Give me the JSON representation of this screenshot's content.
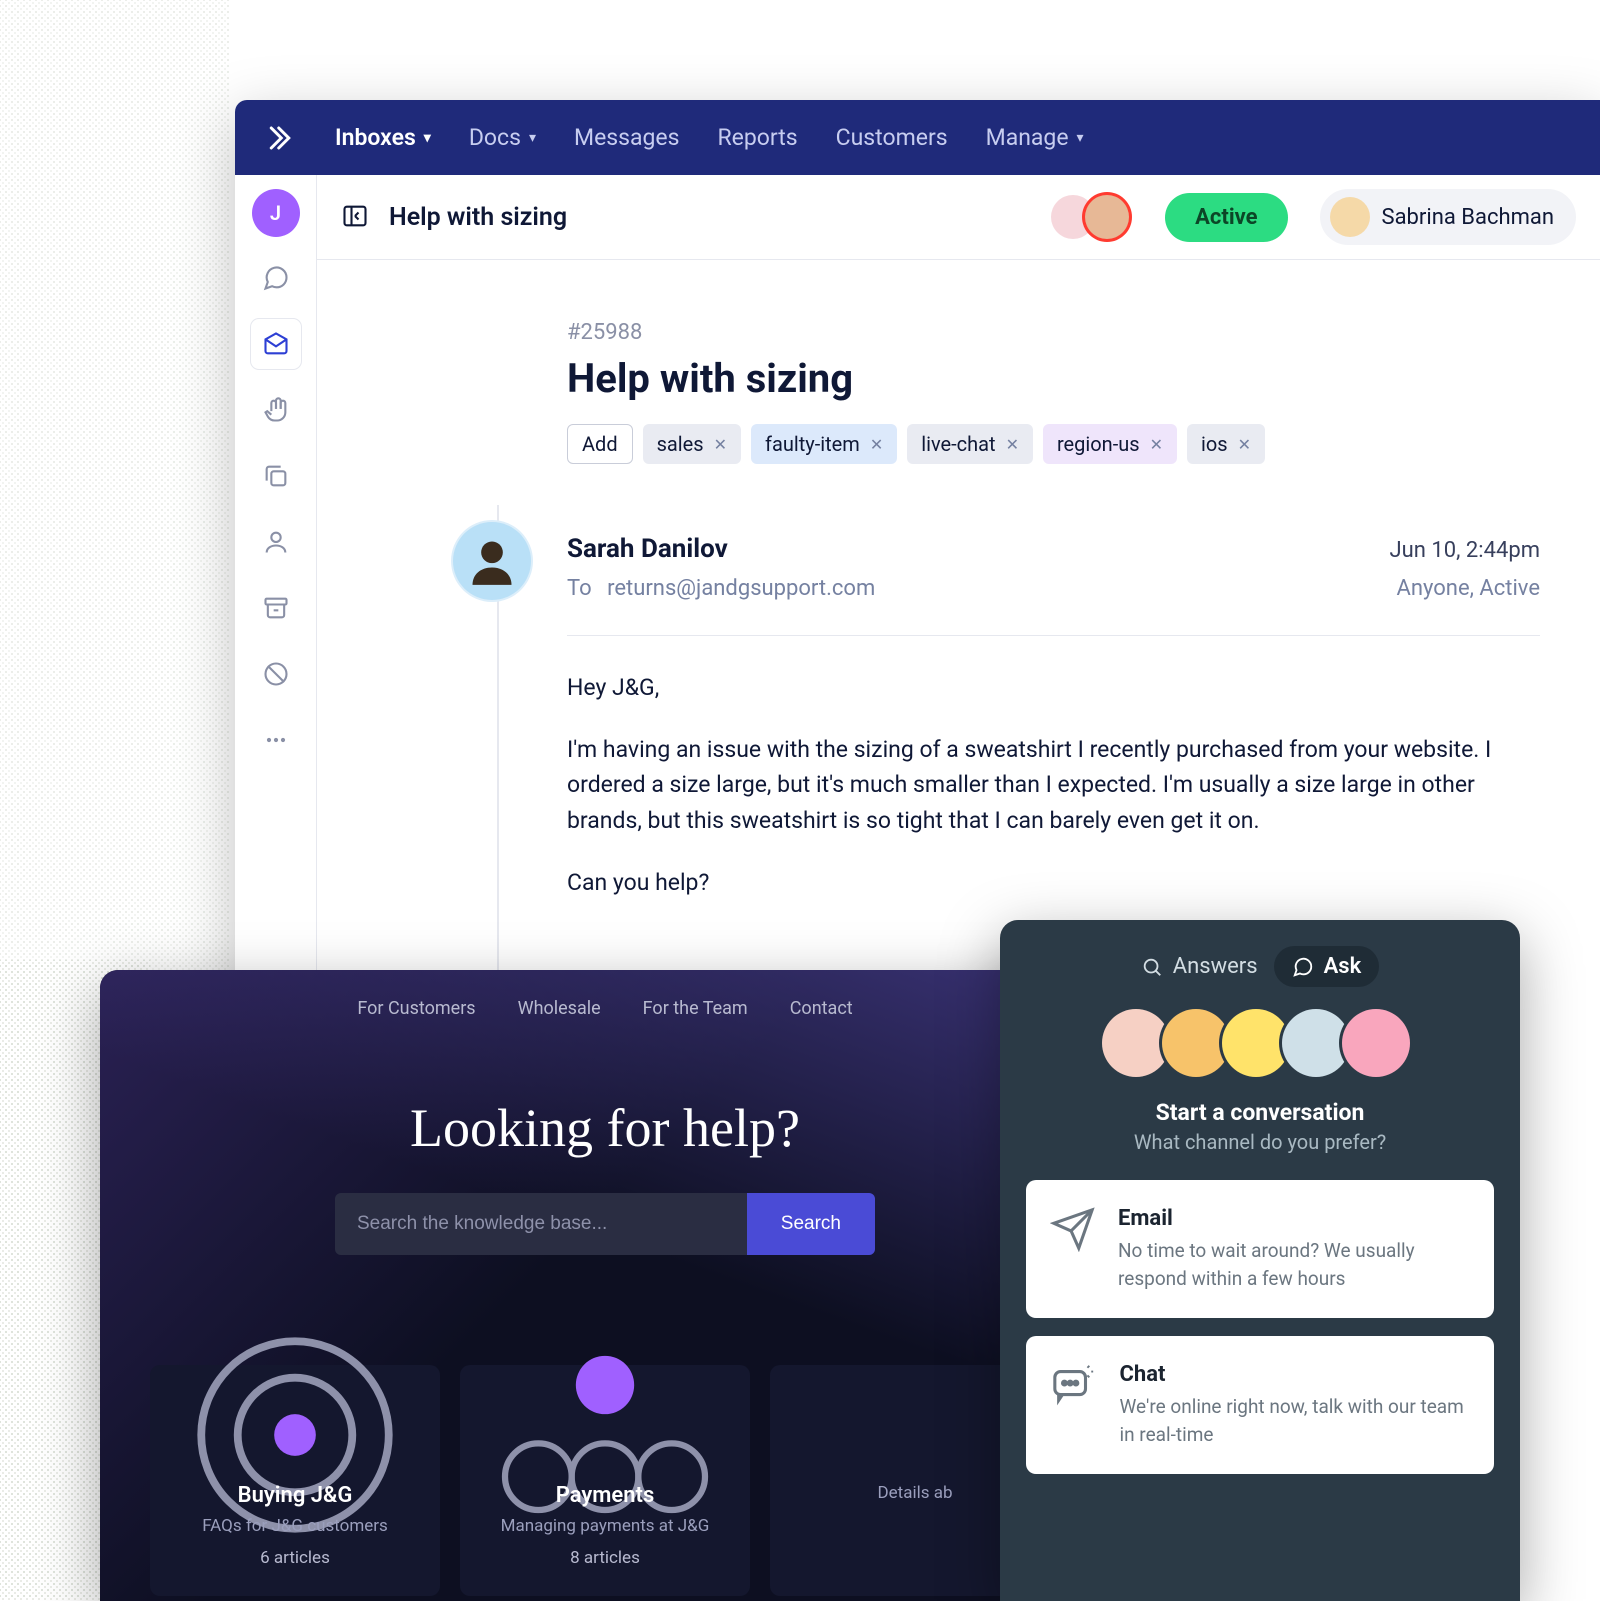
{
  "helpdesk": {
    "nav": {
      "inboxes": "Inboxes",
      "docs": "Docs",
      "messages": "Messages",
      "reports": "Reports",
      "customers": "Customers",
      "manage": "Manage"
    },
    "rail": {
      "avatar_letter": "J"
    },
    "header": {
      "title": "Help with sizing",
      "status": "Active",
      "assignee": "Sabrina Bachman"
    },
    "ticket": {
      "id": "#25988",
      "title": "Help with sizing",
      "add_label": "Add",
      "tags": [
        "sales",
        "faulty-item",
        "live-chat",
        "region-us",
        "ios"
      ]
    },
    "message": {
      "from": "Sarah Danilov",
      "date": "Jun 10, 2:44pm",
      "to_label": "To",
      "to_addr": "returns@jandgsupport.com",
      "meta": "Anyone, Active",
      "body": [
        "Hey J&G,",
        "I'm having an issue with the sizing of a sweatshirt I recently purchased from your website. I ordered a size large, but it's much smaller than I expected. I'm usually a size large in other brands, but this sweatshirt is so tight that I can barely even get it on.",
        "Can you help?"
      ]
    }
  },
  "kb": {
    "nav": [
      "For Customers",
      "Wholesale",
      "For the Team",
      "Contact"
    ],
    "hero": "Looking for help?",
    "search_placeholder": "Search the knowledge base...",
    "search_button": "Search",
    "cards": [
      {
        "title": "Buying J&G",
        "subtitle": "FAQs for J&G customers",
        "count": "6 articles"
      },
      {
        "title": "Payments",
        "subtitle": "Managing payments at J&G",
        "count": "8 articles"
      },
      {
        "title": "",
        "subtitle": "Details ab",
        "count": ""
      }
    ]
  },
  "widget": {
    "tabs": {
      "answers": "Answers",
      "ask": "Ask"
    },
    "title": "Start a conversation",
    "subtitle": "What channel do you prefer?",
    "channels": [
      {
        "name": "Email",
        "desc": "No time to wait around? We usually respond within a few hours"
      },
      {
        "name": "Chat",
        "desc": "We're online right now, talk with our team in real-time"
      }
    ]
  }
}
